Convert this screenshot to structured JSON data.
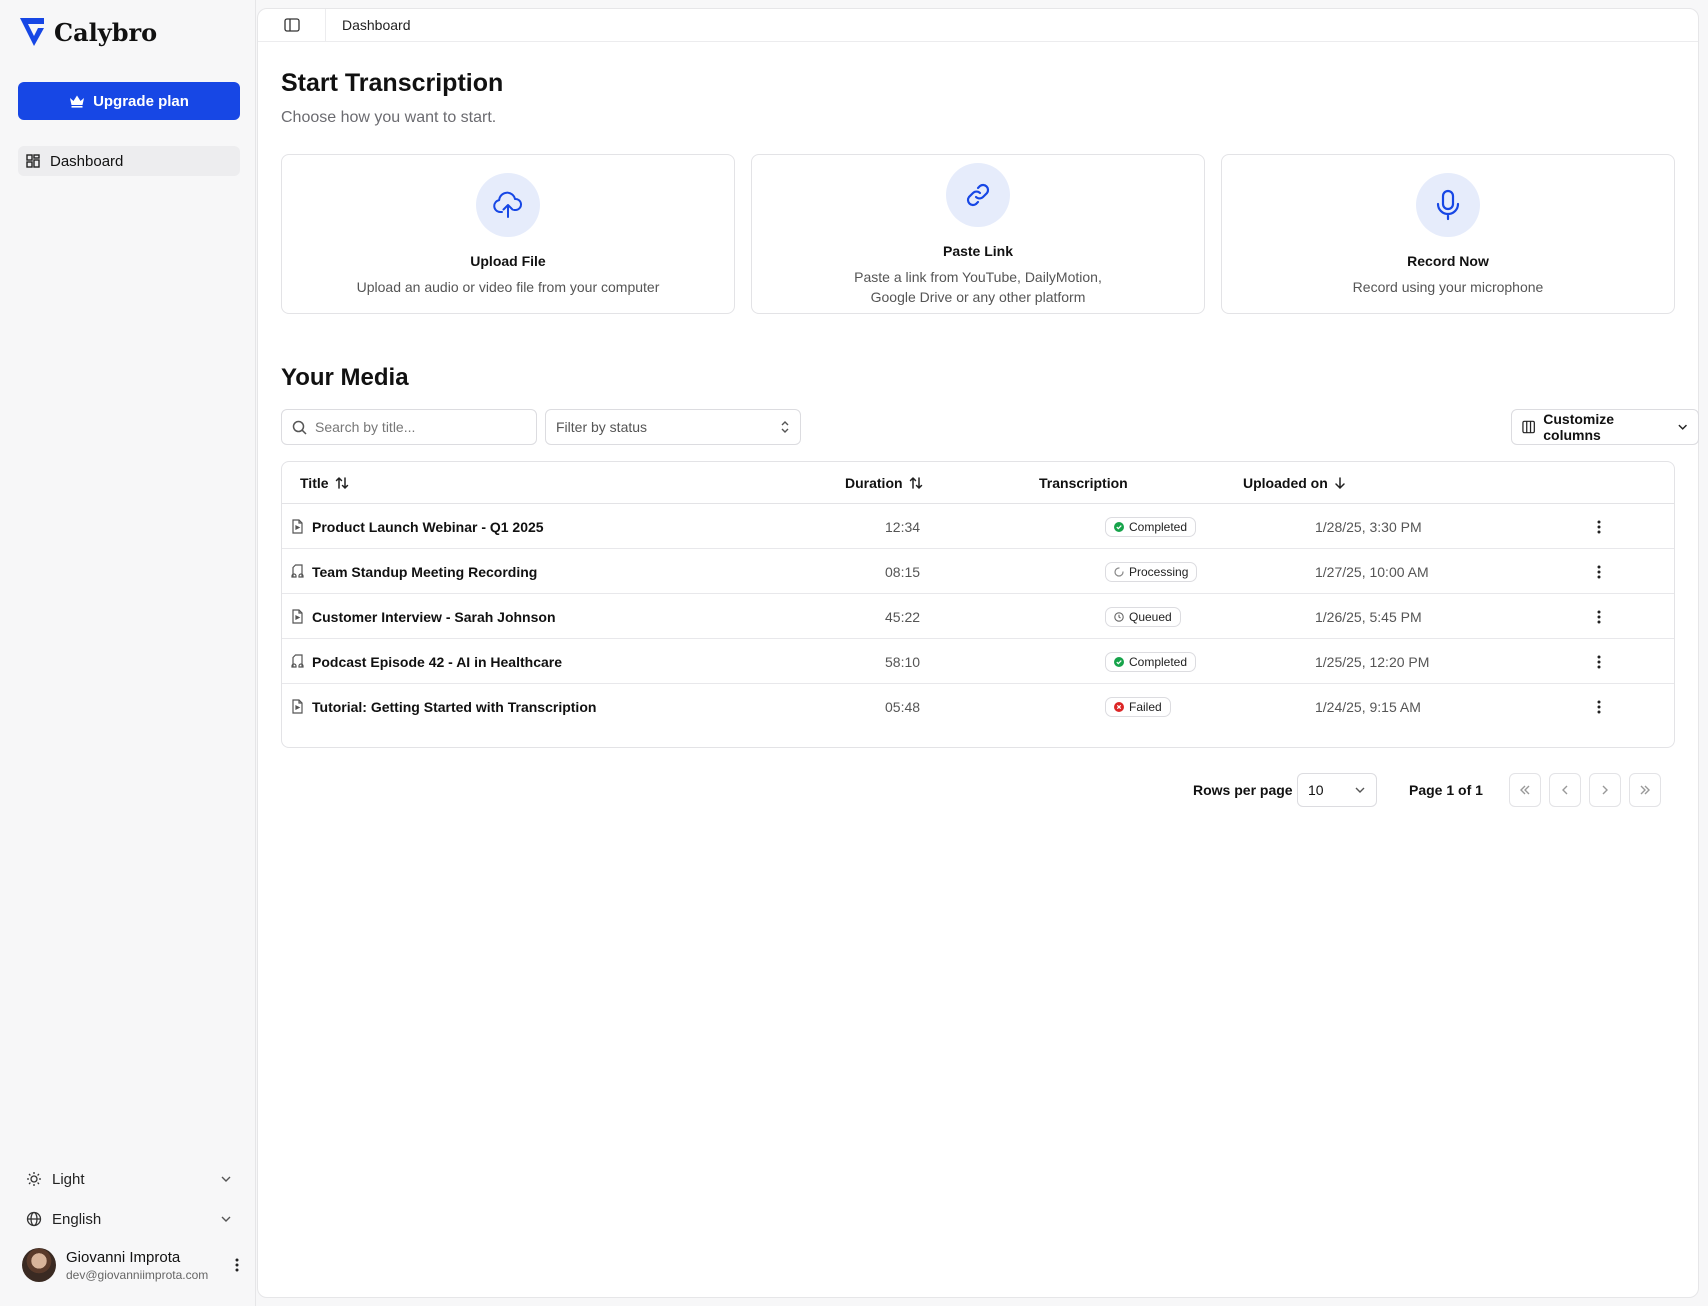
{
  "app": {
    "name": "Calybro",
    "brand_color": "#1747e5"
  },
  "sidebar": {
    "upgrade_label": "Upgrade plan",
    "nav": [
      {
        "label": "Dashboard",
        "icon": "dashboard-icon",
        "active": true
      }
    ],
    "theme": {
      "value": "Light",
      "icon": "sun-icon"
    },
    "language": {
      "value": "English",
      "icon": "globe-icon"
    },
    "user": {
      "name": "Giovanni Improta",
      "email": "dev@giovanniimprota.com"
    }
  },
  "header": {
    "breadcrumb": "Dashboard"
  },
  "start": {
    "title": "Start Transcription",
    "subtitle": "Choose how you want to start.",
    "cards": [
      {
        "title": "Upload File",
        "description": "Upload an audio or video file from your computer",
        "icon": "upload-cloud-icon"
      },
      {
        "title": "Paste Link",
        "description": "Paste a link from YouTube, DailyMotion, Google Drive or any other platform",
        "icon": "link-icon"
      },
      {
        "title": "Record Now",
        "description": "Record using your microphone",
        "icon": "microphone-icon"
      }
    ]
  },
  "media": {
    "title": "Your Media",
    "search_placeholder": "Search by title...",
    "filter_placeholder": "Filter by status",
    "customize_label": "Customize columns",
    "columns": {
      "title": "Title",
      "duration": "Duration",
      "transcription": "Transcription",
      "uploaded": "Uploaded on"
    },
    "rows": [
      {
        "title": "Product Launch Webinar - Q1 2025",
        "type": "video",
        "duration": "12:34",
        "status": "Completed",
        "uploaded": "1/28/25, 3:30 PM"
      },
      {
        "title": "Team Standup Meeting Recording",
        "type": "audio",
        "duration": "08:15",
        "status": "Processing",
        "uploaded": "1/27/25, 10:00 AM"
      },
      {
        "title": "Customer Interview - Sarah Johnson",
        "type": "video",
        "duration": "45:22",
        "status": "Queued",
        "uploaded": "1/26/25, 5:45 PM"
      },
      {
        "title": "Podcast Episode 42 - AI in Healthcare",
        "type": "audio",
        "duration": "58:10",
        "status": "Completed",
        "uploaded": "1/25/25, 12:20 PM"
      },
      {
        "title": "Tutorial: Getting Started with Transcription",
        "type": "video",
        "duration": "05:48",
        "status": "Failed",
        "uploaded": "1/24/25, 9:15 AM"
      }
    ],
    "status_colors": {
      "Completed": "#16a34a",
      "Failed": "#dc2626",
      "Processing": "#888888",
      "Queued": "#666666"
    }
  },
  "pagination": {
    "rows_per_page_label": "Rows per page",
    "rows_per_page": "10",
    "page_info": "Page 1 of 1"
  }
}
